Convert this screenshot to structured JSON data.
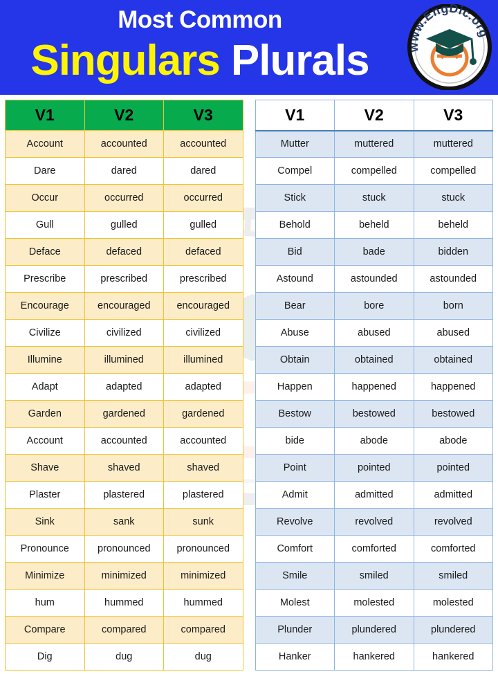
{
  "banner": {
    "title_small": "Most Common",
    "title_word_1": "Singulars",
    "title_word_2": "Plurals",
    "colors": {
      "background": "#2535E8",
      "title_small_color": "#FFFFFF",
      "word1_color": "#FFF500",
      "word2_color": "#FFFFFF"
    },
    "logo": {
      "name": "engdic-logo",
      "text": "www.EngDic.org",
      "letter": "e",
      "ring_color": "#FFFFFF",
      "outline_color": "#111111",
      "text_color": "#1F3864",
      "cap_color": "#14504A",
      "letter_color": "#ED7D31"
    }
  },
  "watermark": {
    "text": "www.EngDic.org",
    "letter": "e"
  },
  "left_table": {
    "name": "verb-forms-table-left",
    "accent": "#07AB4E",
    "border": "#F2C230",
    "row_odd_bg": "#FDECC8",
    "row_even_bg": "#FFFFFF",
    "headers": [
      "V1",
      "V2",
      "V3"
    ],
    "rows": [
      [
        "Account",
        "accounted",
        "accounted"
      ],
      [
        "Dare",
        "dared",
        "dared"
      ],
      [
        "Occur",
        "occurred",
        "occurred"
      ],
      [
        "Gull",
        "gulled",
        "gulled"
      ],
      [
        "Deface",
        "defaced",
        "defaced"
      ],
      [
        "Prescribe",
        "prescribed",
        "prescribed"
      ],
      [
        "Encourage",
        "encouraged",
        "encouraged"
      ],
      [
        "Civilize",
        "civilized",
        "civilized"
      ],
      [
        "Illumine",
        "illumined",
        "illumined"
      ],
      [
        "Adapt",
        "adapted",
        "adapted"
      ],
      [
        "Garden",
        "gardened",
        "gardened"
      ],
      [
        "Account",
        "accounted",
        "accounted"
      ],
      [
        "Shave",
        "shaved",
        "shaved"
      ],
      [
        "Plaster",
        "plastered",
        "plastered"
      ],
      [
        "Sink",
        "sank",
        "sunk"
      ],
      [
        "Pronounce",
        "pronounced",
        "pronounced"
      ],
      [
        "Minimize",
        "minimized",
        "minimized"
      ],
      [
        "hum",
        "hummed",
        "hummed"
      ],
      [
        "Compare",
        "compared",
        "compared"
      ],
      [
        "Dig",
        "dug",
        "dug"
      ]
    ]
  },
  "right_table": {
    "name": "verb-forms-table-right",
    "accent": "#4A7EBB",
    "border": "#8EB4E3",
    "row_odd_bg": "#DCE6F2",
    "row_even_bg": "#FFFFFF",
    "headers": [
      "V1",
      "V2",
      "V3"
    ],
    "rows": [
      [
        "Mutter",
        "muttered",
        "muttered"
      ],
      [
        "Compel",
        "compelled",
        "compelled"
      ],
      [
        "Stick",
        "stuck",
        "stuck"
      ],
      [
        "Behold",
        "beheld",
        "beheld"
      ],
      [
        "Bid",
        "bade",
        "bidden"
      ],
      [
        "Astound",
        "astounded",
        "astounded"
      ],
      [
        "Bear",
        "bore",
        "born"
      ],
      [
        "Abuse",
        "abused",
        "abused"
      ],
      [
        "Obtain",
        "obtained",
        "obtained"
      ],
      [
        "Happen",
        "happened",
        "happened"
      ],
      [
        "Bestow",
        "bestowed",
        "bestowed"
      ],
      [
        "bide",
        "abode",
        "abode"
      ],
      [
        "Point",
        "pointed",
        "pointed"
      ],
      [
        "Admit",
        "admitted",
        "admitted"
      ],
      [
        "Revolve",
        "revolved",
        "revolved"
      ],
      [
        "Comfort",
        "comforted",
        "comforted"
      ],
      [
        "Smile",
        "smiled",
        "smiled"
      ],
      [
        "Molest",
        "molested",
        "molested"
      ],
      [
        "Plunder",
        "plundered",
        "plundered"
      ],
      [
        "Hanker",
        "hankered",
        "hankered"
      ]
    ]
  }
}
